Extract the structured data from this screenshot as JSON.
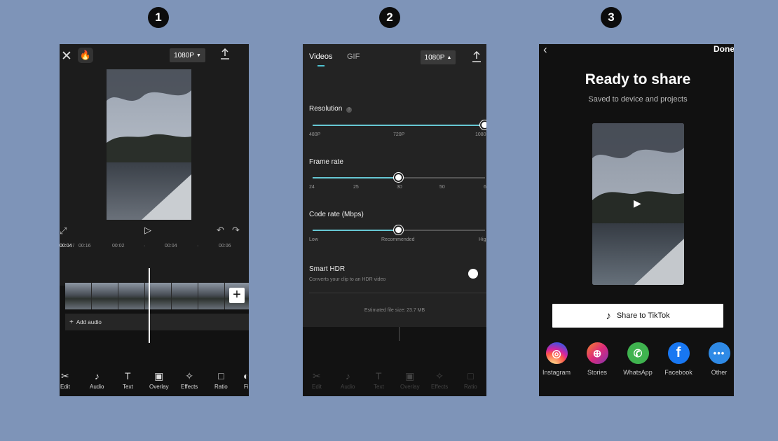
{
  "steps": [
    "1",
    "2",
    "3"
  ],
  "phone1": {
    "resolution": "1080P",
    "timeline": {
      "current_time": "00:04",
      "total_time": "00:16",
      "marks": [
        "00:02",
        "·",
        "00:04",
        "·",
        "00:06"
      ]
    },
    "add_audio_label": "Add audio",
    "tools": [
      "Edit",
      "Audio",
      "Text",
      "Overlay",
      "Effects",
      "Ratio",
      "Fi"
    ]
  },
  "phone2": {
    "tabs": [
      "Videos",
      "GIF"
    ],
    "resolution": "1080P",
    "resolution_section": {
      "label": "Resolution",
      "help": "?",
      "ticks": [
        "480P",
        "720P",
        "1080"
      ],
      "value": 1.0
    },
    "frame_rate_section": {
      "label": "Frame rate",
      "ticks": [
        "24",
        "25",
        "30",
        "50",
        "6"
      ],
      "value": 0.5
    },
    "code_rate_section": {
      "label": "Code rate (Mbps)",
      "ticks": [
        "Low",
        "Recommended",
        "Hig"
      ],
      "value": 0.5
    },
    "smart_hdr": {
      "title": "Smart HDR",
      "subtitle": "Converts your clip to an HDR video"
    },
    "file_size": "Estimated file size: 23.7 MB",
    "tools": [
      "Edit",
      "Audio",
      "Text",
      "Overlay",
      "Effects",
      "Ratio"
    ]
  },
  "phone3": {
    "done_label": "Done",
    "title": "Ready to share",
    "subtitle": "Saved to device and projects",
    "share_tiktok": "Share to TikTok",
    "socials": [
      {
        "label": "Instagram",
        "color": "#d6249f"
      },
      {
        "label": "Stories",
        "color": "#ee3f74"
      },
      {
        "label": "WhatsApp",
        "color": "#3fb34f"
      },
      {
        "label": "Facebook",
        "color": "#1877f2"
      },
      {
        "label": "Other",
        "color": "#2f8ae6"
      }
    ]
  }
}
